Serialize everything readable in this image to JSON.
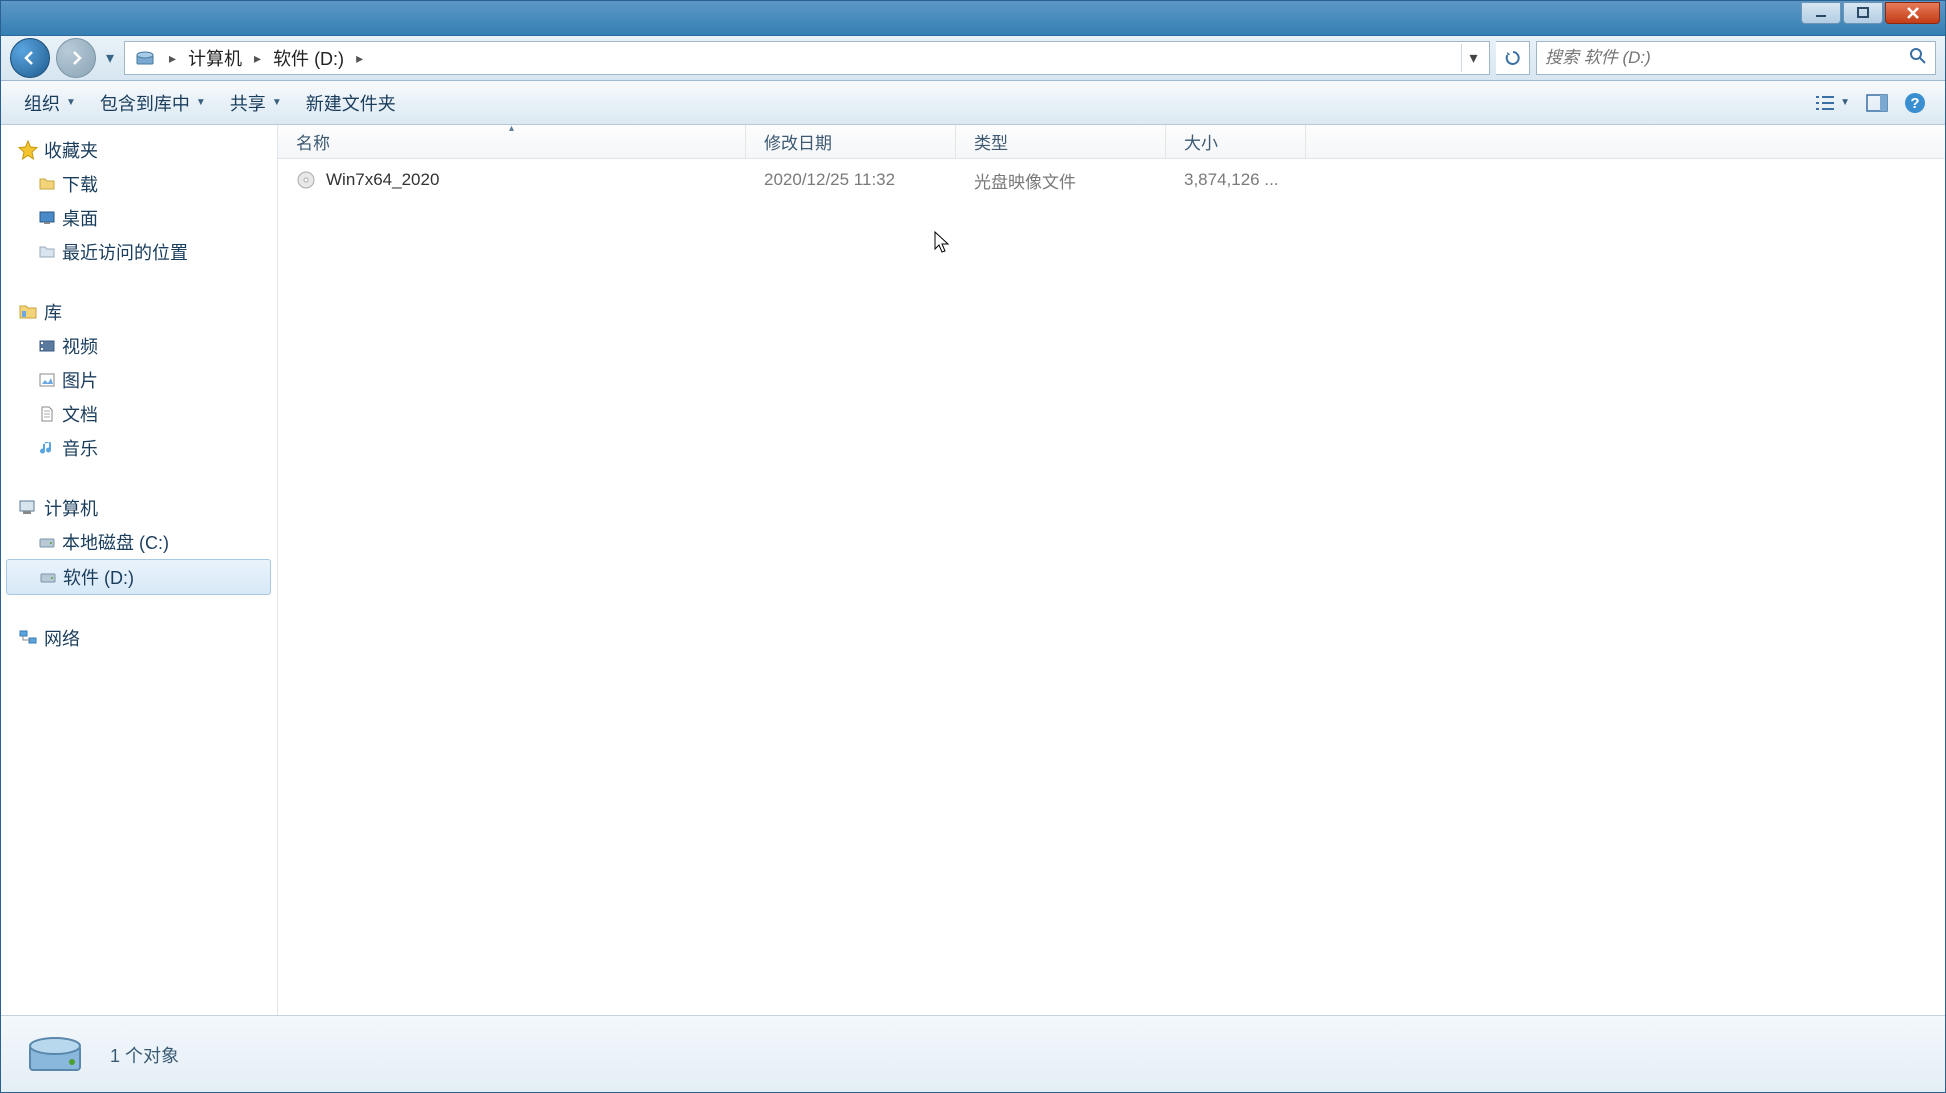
{
  "breadcrumb": {
    "seg1": "计算机",
    "seg2": "软件 (D:)"
  },
  "search": {
    "placeholder": "搜索 软件 (D:)"
  },
  "toolbar": {
    "organize": "组织",
    "include": "包含到库中",
    "share": "共享",
    "newfolder": "新建文件夹"
  },
  "sidebar": {
    "favorites": {
      "head": "收藏夹",
      "items": [
        "下载",
        "桌面",
        "最近访问的位置"
      ]
    },
    "libraries": {
      "head": "库",
      "items": [
        "视频",
        "图片",
        "文档",
        "音乐"
      ]
    },
    "computer": {
      "head": "计算机",
      "items": [
        "本地磁盘 (C:)",
        "软件 (D:)"
      ]
    },
    "network": {
      "head": "网络"
    }
  },
  "columns": {
    "name": "名称",
    "date": "修改日期",
    "type": "类型",
    "size": "大小"
  },
  "files": [
    {
      "name": "Win7x64_2020",
      "date": "2020/12/25 11:32",
      "type": "光盘映像文件",
      "size": "3,874,126 ..."
    }
  ],
  "statusbar": {
    "text": "1 个对象"
  }
}
